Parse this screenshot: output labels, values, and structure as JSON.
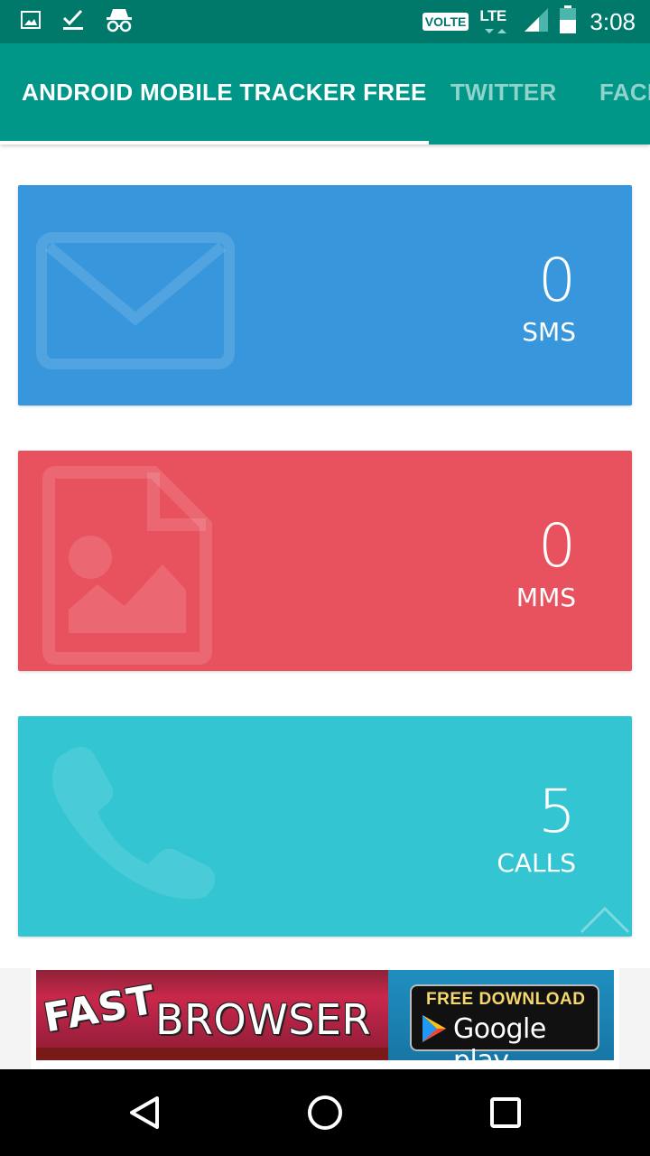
{
  "status_bar": {
    "time": "3:08",
    "volte": "VOLTE",
    "network": "LTE",
    "icons": [
      "image-icon",
      "check-icon",
      "incognito-icon",
      "signal-icon",
      "battery-icon"
    ]
  },
  "tabs": [
    {
      "label": "ANDROID MOBILE TRACKER FREE",
      "active": true
    },
    {
      "label": "TWITTER",
      "active": false
    },
    {
      "label": "FACE",
      "active": false
    }
  ],
  "cards": [
    {
      "count": "0",
      "label": "SMS",
      "color": "#3897dc",
      "icon": "envelope-icon"
    },
    {
      "count": "0",
      "label": "MMS",
      "color": "#e8525f",
      "icon": "image-file-icon"
    },
    {
      "count": "5",
      "label": "CALLS",
      "color": "#33c6d2",
      "icon": "phone-icon"
    }
  ],
  "ad": {
    "headline_1": "FAST",
    "headline_2": "BROWSER",
    "cta_top": "FREE DOWNLOAD",
    "cta_store": "Google play"
  },
  "colors": {
    "status_bar": "#00796b",
    "tab_bar": "#009688",
    "tab_inactive_text": "#8fd3cb"
  },
  "nav_bar": {
    "icons": [
      "back-icon",
      "home-icon",
      "recents-icon"
    ]
  }
}
